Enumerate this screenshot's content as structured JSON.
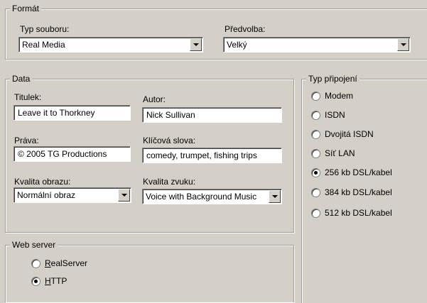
{
  "format": {
    "title": "Formát",
    "file_type": {
      "label": "Typ souboru:",
      "value": "Real Media"
    },
    "preset": {
      "label": "Předvolba:",
      "value": "Velký"
    }
  },
  "data": {
    "title": "Data",
    "titulek": {
      "label": "Titulek:",
      "value": "Leave it to Thorkney"
    },
    "autor": {
      "label": "Autor:",
      "value": "Nick Sullivan"
    },
    "prava": {
      "label": "Práva:",
      "value": "© 2005 TG Productions"
    },
    "klicova_slova": {
      "label": "Klíčová slova:",
      "value": "comedy, trumpet, fishing trips"
    },
    "kvalita_obrazu": {
      "label": "Kvalita obrazu:",
      "value": "Normální obraz"
    },
    "kvalita_zvuku": {
      "label": "Kvalita zvuku:",
      "value": "Voice with Background Music"
    }
  },
  "connection": {
    "title": "Typ připojení",
    "options": [
      "Modem",
      "ISDN",
      "Dvojitá ISDN",
      "Síť LAN",
      "256 kb DSL/kabel",
      "384 kb DSL/kabel",
      "512 kb DSL/kabel"
    ],
    "selected": "256 kb DSL/kabel"
  },
  "web_server": {
    "title": "Web server",
    "options": [
      {
        "first": "R",
        "rest": "ealServer"
      },
      {
        "first": "H",
        "rest": "TTP"
      }
    ],
    "selected": "HTTP"
  }
}
